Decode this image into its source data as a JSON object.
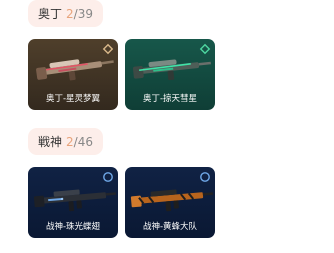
{
  "groups": [
    {
      "name": "奥丁",
      "collected": "2",
      "separator": "/",
      "total": "39",
      "items": [
        {
          "label": "奥丁-星灵梦翼",
          "badge_icon": "diamond-badge-icon",
          "accent": "#d9b88a"
        },
        {
          "label": "奥丁-掠天彗星",
          "badge_icon": "diamond-badge-icon",
          "accent": "#4ed6a0"
        }
      ]
    },
    {
      "name": "戦神",
      "collected": "2",
      "separator": "/",
      "total": "46",
      "items": [
        {
          "label": "战神-珠光蝶翅",
          "badge_icon": "ring-badge-icon",
          "accent": "#6fa8e8"
        },
        {
          "label": "战神-黄蜂大队",
          "badge_icon": "ring-badge-icon",
          "accent": "#e08a2e"
        }
      ]
    }
  ]
}
